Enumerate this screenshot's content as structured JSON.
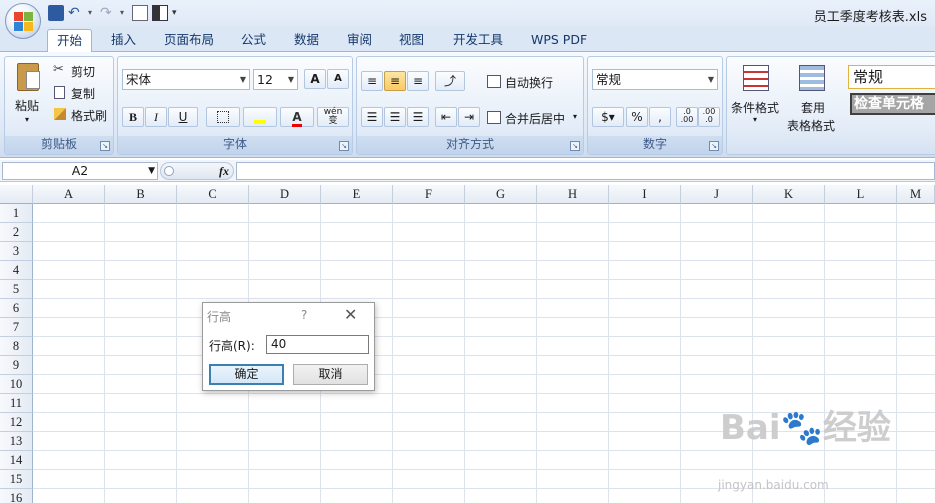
{
  "window": {
    "title": "员工季度考核表.xls"
  },
  "tabs": [
    "开始",
    "插入",
    "页面布局",
    "公式",
    "数据",
    "审阅",
    "视图",
    "开发工具",
    "WPS PDF"
  ],
  "active_tab_index": 0,
  "clipboard": {
    "paste": "粘贴",
    "cut": "剪切",
    "copy": "复制",
    "format_painter": "格式刷",
    "group_label": "剪贴板"
  },
  "font": {
    "name": "宋体",
    "size": "12",
    "bold": "B",
    "italic": "I",
    "underline": "U",
    "phonetic": "wén 变",
    "grow": "A",
    "shrink": "A",
    "group_label": "字体"
  },
  "alignment": {
    "wrap": "自动换行",
    "merge": "合并后居中",
    "group_label": "对齐方式"
  },
  "number": {
    "format": "常规",
    "percent": "%",
    "comma": ",",
    "inc_dec": ".0 .00",
    "dec_dec": ".00 .0",
    "group_label": "数字"
  },
  "styles": {
    "conditional": "条件格式",
    "table_style_top": "套用",
    "table_style_bottom": "表格格式",
    "cell_style_normal": "常规",
    "cell_style_check": "检查单元格"
  },
  "formula_bar": {
    "name_box": "A2",
    "fx": "fx",
    "value": ""
  },
  "columns": [
    "A",
    "B",
    "C",
    "D",
    "E",
    "F",
    "G",
    "H",
    "I",
    "J",
    "K",
    "L",
    "M"
  ],
  "rows": [
    "1",
    "2",
    "3",
    "4",
    "5",
    "6",
    "7",
    "8",
    "9",
    "10",
    "11",
    "12",
    "13",
    "14",
    "15",
    "16"
  ],
  "dialog": {
    "title": "行高",
    "help": "?",
    "close": "✕",
    "label": "行高(R):",
    "value": "40",
    "ok": "确定",
    "cancel": "取消"
  },
  "watermark": {
    "main": "Bai🐾经验",
    "url": "jingyan.baidu.com"
  }
}
